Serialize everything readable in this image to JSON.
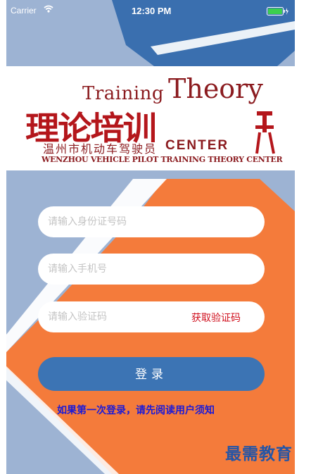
{
  "status_bar": {
    "carrier": "Carrier",
    "time": "12:30 PM"
  },
  "logo": {
    "training": "Training",
    "theory": "Theory",
    "title_cn": "理论培训",
    "subtitle_cn": "温州市机动车驾驶员",
    "center": "CENTER",
    "english": "WENZHOU VEHICLE PILOT TRAINING THEORY CENTER"
  },
  "form": {
    "id_placeholder": "请输入身份证号码",
    "phone_placeholder": "请输入手机号",
    "code_placeholder": "请输入验证码",
    "get_code_label": "获取验证码",
    "login_label": "登录",
    "notice": "如果第一次登录，请先阅读用户须知"
  },
  "watermark": "最需教育",
  "colors": {
    "accent_blue": "#3c74b4",
    "orange": "#f47b3b",
    "light_blue": "#9db3d3",
    "brand_red": "#8b1b1f"
  }
}
